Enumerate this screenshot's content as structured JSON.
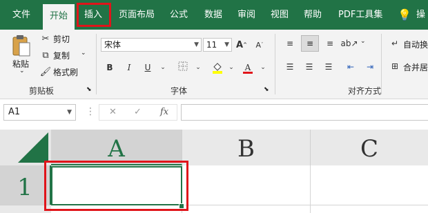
{
  "ribbon_tabs": {
    "file": "文件",
    "home": "开始",
    "insert": "插入",
    "page_layout": "页面布局",
    "formulas": "公式",
    "data": "数据",
    "review": "审阅",
    "view": "视图",
    "help": "帮助",
    "pdf_tools": "PDF工具集",
    "tell_me": "操"
  },
  "clipboard": {
    "paste": "粘贴",
    "cut": "剪切",
    "copy": "复制",
    "format_painter": "格式刷",
    "group_label": "剪贴板"
  },
  "font": {
    "family": "宋体",
    "size": "11",
    "group_label": "字体",
    "bold": "B",
    "italic": "I",
    "underline": "U",
    "font_color_letter": "A"
  },
  "alignment": {
    "wrap_text": "自动换",
    "merge_center": "合并居",
    "group_label": "对齐方式"
  },
  "formula_bar": {
    "name_box": "A1",
    "cancel_icon": "✕",
    "enter_icon": "✓",
    "fx_label": "fx",
    "formula_value": ""
  },
  "grid": {
    "columns": [
      "A",
      "B",
      "C"
    ],
    "rows": [
      "1"
    ],
    "cell_A1": ""
  },
  "colors": {
    "accent": "#217346",
    "highlight": "#e0141a"
  }
}
